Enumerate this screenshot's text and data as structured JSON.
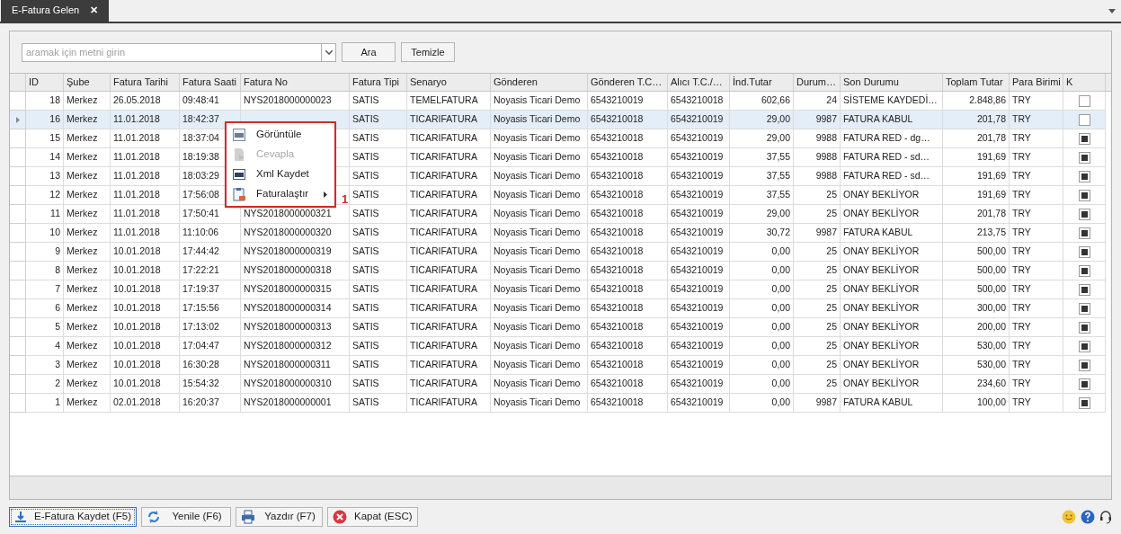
{
  "tab": {
    "title": "E-Fatura Gelen",
    "close": "✕"
  },
  "search": {
    "placeholder": "aramak için metni girin",
    "buttons": [
      "Ara",
      "Temizle"
    ]
  },
  "table": {
    "columns": [
      "ID",
      "Şube",
      "Fatura Tarihi",
      "Fatura Saati",
      "Fatura No",
      "Fatura Tipi",
      "Senaryo",
      "Gönderen",
      "Gönderen T.C…",
      "Alıcı T.C./…",
      "İnd.Tutar",
      "Durum…",
      "Son Durumu",
      "Toplam Tutar",
      "Para Birimi",
      "K"
    ],
    "rows": [
      {
        "id": "18",
        "sube": "Merkez",
        "tarih": "26.05.2018",
        "saat": "09:48:41",
        "fatura_no": "NYS2018000000023",
        "tipi": "SATIS",
        "senaryo": "TEMELFATURA",
        "gonderen": "Noyasis Ticari Demo",
        "gonderen_tc": "6543210019",
        "alici_tc": "6543210018",
        "ind_tutar": "602,66",
        "durum": "24",
        "son_durum": "SİSTEME KAYDEDİ…",
        "toplam": "2.848,86",
        "para": "TRY",
        "checked": false,
        "selected": false
      },
      {
        "id": "16",
        "sube": "Merkez",
        "tarih": "11.01.2018",
        "saat": "18:42:37",
        "tipi": "SATIS",
        "senaryo": "TICARIFATURA",
        "gonderen": "Noyasis Ticari Demo",
        "gonderen_tc": "6543210018",
        "alici_tc": "6543210019",
        "ind_tutar": "29,00",
        "durum": "9987",
        "son_durum": "FATURA KABUL",
        "toplam": "201,78",
        "para": "TRY",
        "checked": false,
        "selected": true
      },
      {
        "id": "15",
        "sube": "Merkez",
        "tarih": "11.01.2018",
        "saat": "18:37:04",
        "tipi": "SATIS",
        "senaryo": "TICARIFATURA",
        "gonderen": "Noyasis Ticari Demo",
        "gonderen_tc": "6543210018",
        "alici_tc": "6543210019",
        "ind_tutar": "29,00",
        "durum": "9988",
        "son_durum": "FATURA RED - dg…",
        "toplam": "201,78",
        "para": "TRY",
        "checked": true,
        "selected": false
      },
      {
        "id": "14",
        "sube": "Merkez",
        "tarih": "11.01.2018",
        "saat": "18:19:38",
        "tipi": "SATIS",
        "senaryo": "TICARIFATURA",
        "gonderen": "Noyasis Ticari Demo",
        "gonderen_tc": "6543210018",
        "alici_tc": "6543210019",
        "ind_tutar": "37,55",
        "durum": "9988",
        "son_durum": "FATURA RED - sd…",
        "toplam": "191,69",
        "para": "TRY",
        "checked": true,
        "selected": false
      },
      {
        "id": "13",
        "sube": "Merkez",
        "tarih": "11.01.2018",
        "saat": "18:03:29",
        "tipi": "SATIS",
        "senaryo": "TICARIFATURA",
        "gonderen": "Noyasis Ticari Demo",
        "gonderen_tc": "6543210018",
        "alici_tc": "6543210019",
        "ind_tutar": "37,55",
        "durum": "9988",
        "son_durum": "FATURA RED - sd…",
        "toplam": "191,69",
        "para": "TRY",
        "checked": true,
        "selected": false
      },
      {
        "id": "12",
        "sube": "Merkez",
        "tarih": "11.01.2018",
        "saat": "17:56:08",
        "tipi": "SATIS",
        "senaryo": "TICARIFATURA",
        "gonderen": "Noyasis Ticari Demo",
        "gonderen_tc": "6543210018",
        "alici_tc": "6543210019",
        "ind_tutar": "37,55",
        "durum": "25",
        "son_durum": "ONAY BEKLİYOR",
        "toplam": "191,69",
        "para": "TRY",
        "checked": true,
        "selected": false
      },
      {
        "id": "11",
        "sube": "Merkez",
        "tarih": "11.01.2018",
        "saat": "17:50:41",
        "fatura_no": "NYS2018000000321",
        "tipi": "SATIS",
        "senaryo": "TICARIFATURA",
        "gonderen": "Noyasis Ticari Demo",
        "gonderen_tc": "6543210018",
        "alici_tc": "6543210019",
        "ind_tutar": "29,00",
        "durum": "25",
        "son_durum": "ONAY BEKLİYOR",
        "toplam": "201,78",
        "para": "TRY",
        "checked": true,
        "selected": false
      },
      {
        "id": "10",
        "sube": "Merkez",
        "tarih": "11.01.2018",
        "saat": "11:10:06",
        "fatura_no": "NYS2018000000320",
        "tipi": "SATIS",
        "senaryo": "TICARIFATURA",
        "gonderen": "Noyasis Ticari Demo",
        "gonderen_tc": "6543210018",
        "alici_tc": "6543210019",
        "ind_tutar": "30,72",
        "durum": "9987",
        "son_durum": "FATURA KABUL",
        "toplam": "213,75",
        "para": "TRY",
        "checked": true,
        "selected": false
      },
      {
        "id": "9",
        "sube": "Merkez",
        "tarih": "10.01.2018",
        "saat": "17:44:42",
        "fatura_no": "NYS2018000000319",
        "tipi": "SATIS",
        "senaryo": "TICARIFATURA",
        "gonderen": "Noyasis Ticari Demo",
        "gonderen_tc": "6543210018",
        "alici_tc": "6543210019",
        "ind_tutar": "0,00",
        "durum": "25",
        "son_durum": "ONAY BEKLİYOR",
        "toplam": "500,00",
        "para": "TRY",
        "checked": true,
        "selected": false
      },
      {
        "id": "8",
        "sube": "Merkez",
        "tarih": "10.01.2018",
        "saat": "17:22:21",
        "fatura_no": "NYS2018000000318",
        "tipi": "SATIS",
        "senaryo": "TICARIFATURA",
        "gonderen": "Noyasis Ticari Demo",
        "gonderen_tc": "6543210018",
        "alici_tc": "6543210019",
        "ind_tutar": "0,00",
        "durum": "25",
        "son_durum": "ONAY BEKLİYOR",
        "toplam": "500,00",
        "para": "TRY",
        "checked": true,
        "selected": false
      },
      {
        "id": "7",
        "sube": "Merkez",
        "tarih": "10.01.2018",
        "saat": "17:19:37",
        "fatura_no": "NYS2018000000315",
        "tipi": "SATIS",
        "senaryo": "TICARIFATURA",
        "gonderen": "Noyasis Ticari Demo",
        "gonderen_tc": "6543210018",
        "alici_tc": "6543210019",
        "ind_tutar": "0,00",
        "durum": "25",
        "son_durum": "ONAY BEKLİYOR",
        "toplam": "500,00",
        "para": "TRY",
        "checked": true,
        "selected": false
      },
      {
        "id": "6",
        "sube": "Merkez",
        "tarih": "10.01.2018",
        "saat": "17:15:56",
        "fatura_no": "NYS2018000000314",
        "tipi": "SATIS",
        "senaryo": "TICARIFATURA",
        "gonderen": "Noyasis Ticari Demo",
        "gonderen_tc": "6543210018",
        "alici_tc": "6543210019",
        "ind_tutar": "0,00",
        "durum": "25",
        "son_durum": "ONAY BEKLİYOR",
        "toplam": "300,00",
        "para": "TRY",
        "checked": true,
        "selected": false
      },
      {
        "id": "5",
        "sube": "Merkez",
        "tarih": "10.01.2018",
        "saat": "17:13:02",
        "fatura_no": "NYS2018000000313",
        "tipi": "SATIS",
        "senaryo": "TICARIFATURA",
        "gonderen": "Noyasis Ticari Demo",
        "gonderen_tc": "6543210018",
        "alici_tc": "6543210019",
        "ind_tutar": "0,00",
        "durum": "25",
        "son_durum": "ONAY BEKLİYOR",
        "toplam": "200,00",
        "para": "TRY",
        "checked": true,
        "selected": false
      },
      {
        "id": "4",
        "sube": "Merkez",
        "tarih": "10.01.2018",
        "saat": "17:04:47",
        "fatura_no": "NYS2018000000312",
        "tipi": "SATIS",
        "senaryo": "TICARIFATURA",
        "gonderen": "Noyasis Ticari Demo",
        "gonderen_tc": "6543210018",
        "alici_tc": "6543210019",
        "ind_tutar": "0,00",
        "durum": "25",
        "son_durum": "ONAY BEKLİYOR",
        "toplam": "530,00",
        "para": "TRY",
        "checked": true,
        "selected": false
      },
      {
        "id": "3",
        "sube": "Merkez",
        "tarih": "10.01.2018",
        "saat": "16:30:28",
        "fatura_no": "NYS2018000000311",
        "tipi": "SATIS",
        "senaryo": "TICARIFATURA",
        "gonderen": "Noyasis Ticari Demo",
        "gonderen_tc": "6543210018",
        "alici_tc": "6543210019",
        "ind_tutar": "0,00",
        "durum": "25",
        "son_durum": "ONAY BEKLİYOR",
        "toplam": "530,00",
        "para": "TRY",
        "checked": true,
        "selected": false
      },
      {
        "id": "2",
        "sube": "Merkez",
        "tarih": "10.01.2018",
        "saat": "15:54:32",
        "fatura_no": "NYS2018000000310",
        "tipi": "SATIS",
        "senaryo": "TICARIFATURA",
        "gonderen": "Noyasis Ticari Demo",
        "gonderen_tc": "6543210018",
        "alici_tc": "6543210019",
        "ind_tutar": "0,00",
        "durum": "25",
        "son_durum": "ONAY BEKLİYOR",
        "toplam": "234,60",
        "para": "TRY",
        "checked": true,
        "selected": false
      },
      {
        "id": "1",
        "sube": "Merkez",
        "tarih": "02.01.2018",
        "saat": "16:20:37",
        "fatura_no": "NYS2018000000001",
        "tipi": "SATIS",
        "senaryo": "TICARIFATURA",
        "gonderen": "Noyasis Ticari Demo",
        "gonderen_tc": "6543210018",
        "alici_tc": "6543210019",
        "ind_tutar": "0,00",
        "durum": "9987",
        "son_durum": "FATURA KABUL",
        "toplam": "100,00",
        "para": "TRY",
        "checked": true,
        "selected": false
      }
    ]
  },
  "context_menu": {
    "items": [
      {
        "label": "Görüntüle",
        "kind": "pdf",
        "disabled": false,
        "submenu": false
      },
      {
        "label": "Cevapla",
        "kind": "reply",
        "disabled": true,
        "submenu": false
      },
      {
        "label": "Xml Kaydet",
        "kind": "xml",
        "disabled": false,
        "submenu": false
      },
      {
        "label": "Faturalaştır",
        "kind": "clipboard",
        "disabled": false,
        "submenu": true
      }
    ],
    "annotation": "1"
  },
  "footer_buttons": [
    {
      "label": "E-Fatura Kaydet (F5)",
      "kind": "download",
      "focused": true
    },
    {
      "label": "Yenile (F6)",
      "kind": "refresh",
      "focused": false
    },
    {
      "label": "Yazdır (F7)",
      "kind": "print",
      "focused": false
    },
    {
      "label": "Kapat (ESC)",
      "kind": "close",
      "focused": false
    }
  ]
}
